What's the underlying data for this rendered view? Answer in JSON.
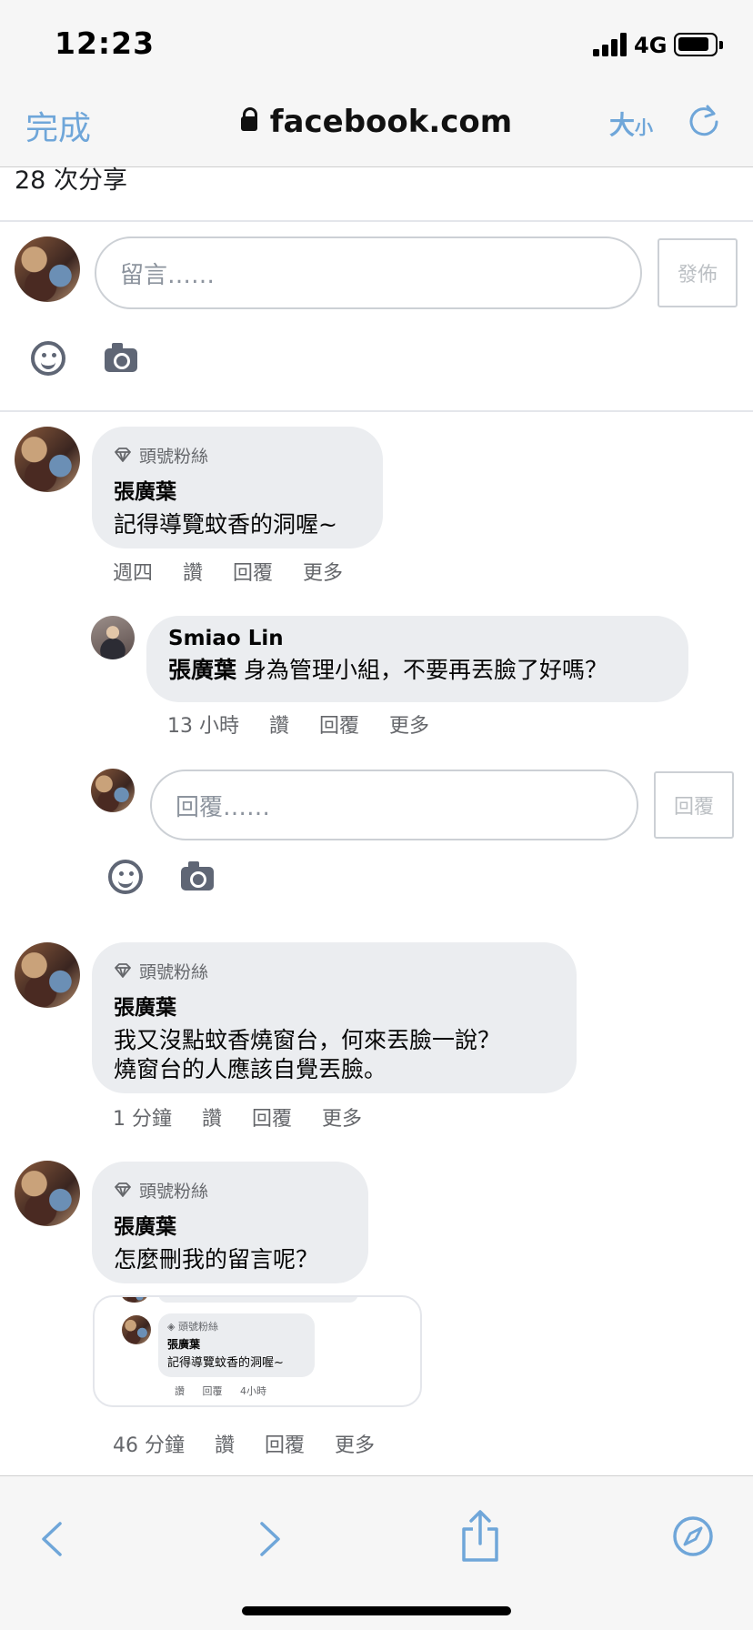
{
  "status_bar": {
    "time": "12:23",
    "network": "4G"
  },
  "browser": {
    "done_label": "完成",
    "url": "facebook.com",
    "text_size_big": "大",
    "text_size_small": "小"
  },
  "post": {
    "shares": "28 次分享"
  },
  "composer": {
    "placeholder": "留言……",
    "post_label": "發佈"
  },
  "comments": [
    {
      "badge": "頭號粉絲",
      "author": "張廣葉",
      "text": "記得導覽蚊香的洞喔~",
      "actions": {
        "time": "週四",
        "like": "讚",
        "reply": "回覆",
        "more": "更多"
      },
      "replies": [
        {
          "author": "Smiao Lin",
          "mention": "張廣葉",
          "text": "身為管理小組，不要再丟臉了好嗎？",
          "actions": {
            "time": "13 小時",
            "like": "讚",
            "reply": "回覆",
            "more": "更多"
          }
        }
      ],
      "reply_composer": {
        "placeholder": "回覆……",
        "post_label": "回覆"
      }
    },
    {
      "badge": "頭號粉絲",
      "author": "張廣葉",
      "text_line1": "我又沒點蚊香燒窗台，何來丟臉一說？",
      "text_line2": "燒窗台的人應該自覺丟臉。",
      "actions": {
        "time": "1 分鐘",
        "like": "讚",
        "reply": "回覆",
        "more": "更多"
      }
    },
    {
      "badge": "頭號粉絲",
      "author": "張廣葉",
      "text": "怎麼刪我的留言呢？",
      "attachment": {
        "badge": "頭號粉絲",
        "author": "張廣葉",
        "text": "記得導覽蚊香的洞喔~",
        "like": "讚",
        "reply": "回覆",
        "time": "4小時"
      },
      "actions": {
        "time": "46 分鐘",
        "like": "讚",
        "reply": "回覆",
        "more": "更多"
      }
    }
  ],
  "colors": {
    "link_blue": "#6fa6d9",
    "bubble_bg": "#ebedf0",
    "meta_gray": "#65676b",
    "icon_gray": "#5f6675"
  },
  "icons": [
    "lock-icon",
    "reload-icon",
    "emoji-icon",
    "camera-icon",
    "diamond-icon",
    "back-icon",
    "forward-icon",
    "share-icon",
    "compass-icon"
  ]
}
